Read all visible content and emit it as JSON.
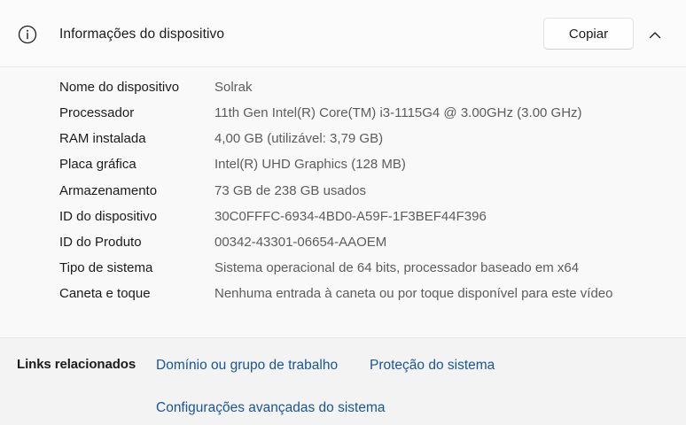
{
  "header": {
    "title": "Informações do dispositivo",
    "copy_label": "Copiar",
    "info_icon": "info-icon",
    "collapse_icon": "chevron-up-icon"
  },
  "specs": [
    {
      "label": "Nome do dispositivo",
      "value": "Solrak"
    },
    {
      "label": "Processador",
      "value": "11th Gen Intel(R) Core(TM) i3-1115G4 @ 3.00GHz (3.00 GHz)"
    },
    {
      "label": "RAM instalada",
      "value": "4,00 GB (utilizável: 3,79 GB)"
    },
    {
      "label": "Placa gráfica",
      "value": "Intel(R) UHD Graphics (128 MB)"
    },
    {
      "label": "Armazenamento",
      "value": "73 GB de 238 GB usados"
    },
    {
      "label": "ID do dispositivo",
      "value": "30C0FFFC-6934-4BD0-A59F-1F3BEF44F396"
    },
    {
      "label": "ID do Produto",
      "value": "00342-43301-06654-AAOEM"
    },
    {
      "label": "Tipo de sistema",
      "value": "Sistema operacional de 64 bits, processador baseado em x64"
    },
    {
      "label": "Caneta e toque",
      "value": "Nenhuma entrada à caneta ou por toque disponível para este vídeo"
    }
  ],
  "related": {
    "label": "Links relacionados",
    "links": [
      "Domínio ou grupo de trabalho",
      "Proteção do sistema",
      "Configurações avançadas do sistema"
    ]
  },
  "colors": {
    "link": "#1a5690",
    "value_text": "#5c5c5c",
    "card_background": "#f9f9f9",
    "page_background": "#f3f3f3"
  }
}
